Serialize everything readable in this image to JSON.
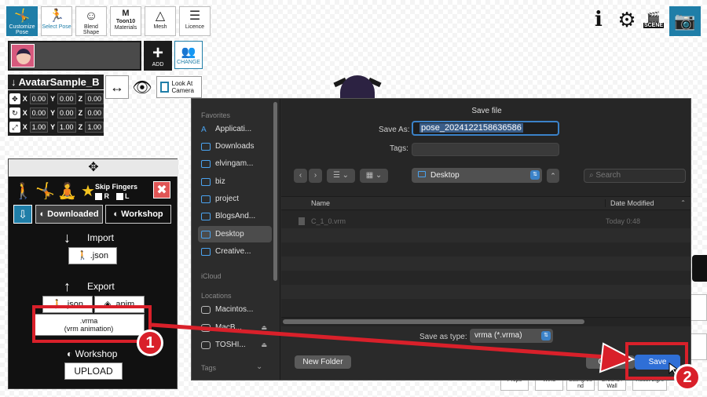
{
  "toolbar": {
    "customize_pose": "Customize Pose",
    "select_pose": "Select Pose",
    "blend_shape": "Blend Shape",
    "materials_top": "M",
    "materials_mid": "Toon10",
    "materials": "Materials",
    "mesh": "Mesh",
    "licence": "Licence"
  },
  "right_toolbar": {
    "info": "i",
    "scene": "SCENE"
  },
  "avatar": {
    "add": "ADD",
    "change": "CHANGE",
    "name": "AvatarSample_B",
    "look_at_camera": "Look At Camera",
    "transform": {
      "pos": [
        "0.00",
        "0.00",
        "0.00"
      ],
      "rot": [
        "0.00",
        "0.00",
        "0.00"
      ],
      "scale": [
        "1.00",
        "1.00",
        "1.00"
      ],
      "axes": [
        "X",
        "Y",
        "Z"
      ]
    }
  },
  "pose_panel": {
    "skip_fingers": "Skip Fingers",
    "r": "R",
    "l": "L",
    "tab_downloaded": "Downloaded",
    "tab_workshop": "Workshop",
    "import_label": "Import",
    "import_json": ".json",
    "export_label": "Export",
    "export_json": ".json",
    "export_anim": ".anim",
    "vrma_line1": ".vrma",
    "vrma_line2": "(vrm animation)",
    "workshop_label": "Workshop",
    "upload": "UPLOAD"
  },
  "bottom_bar": {
    "props": "Props",
    "wind": "Wind",
    "background": "Backgrou nd",
    "ground_wall": "Ground / Wall",
    "reset_light": "Reset Light"
  },
  "dialog": {
    "title": "Save file",
    "save_as_label": "Save As:",
    "save_as_value": "pose_2024122158636586",
    "tags_label": "Tags:",
    "location": "Desktop",
    "search_placeholder": "Search",
    "col_name": "Name",
    "col_date": "Date Modified",
    "files": [
      {
        "name": "C_1_0.vrm",
        "date": "Today 0:48"
      }
    ],
    "save_as_type_label": "Save as type:",
    "save_as_type_value": "vrma (*.vrma)",
    "new_folder": "New Folder",
    "cancel": "Cancel",
    "save": "Save",
    "sidebar": {
      "favorites_head": "Favorites",
      "favorites": [
        "Applicati...",
        "Downloads",
        "elvingam...",
        "biz",
        "project",
        "BlogsAnd...",
        "Desktop",
        "Creative..."
      ],
      "icloud_head": "iCloud",
      "locations_head": "Locations",
      "locations": [
        "Macintos...",
        "MacB...",
        "TOSHI..."
      ],
      "tags_head": "Tags"
    }
  },
  "annotations": {
    "badge1": "1",
    "badge2": "2",
    "color": "#d9202a"
  }
}
